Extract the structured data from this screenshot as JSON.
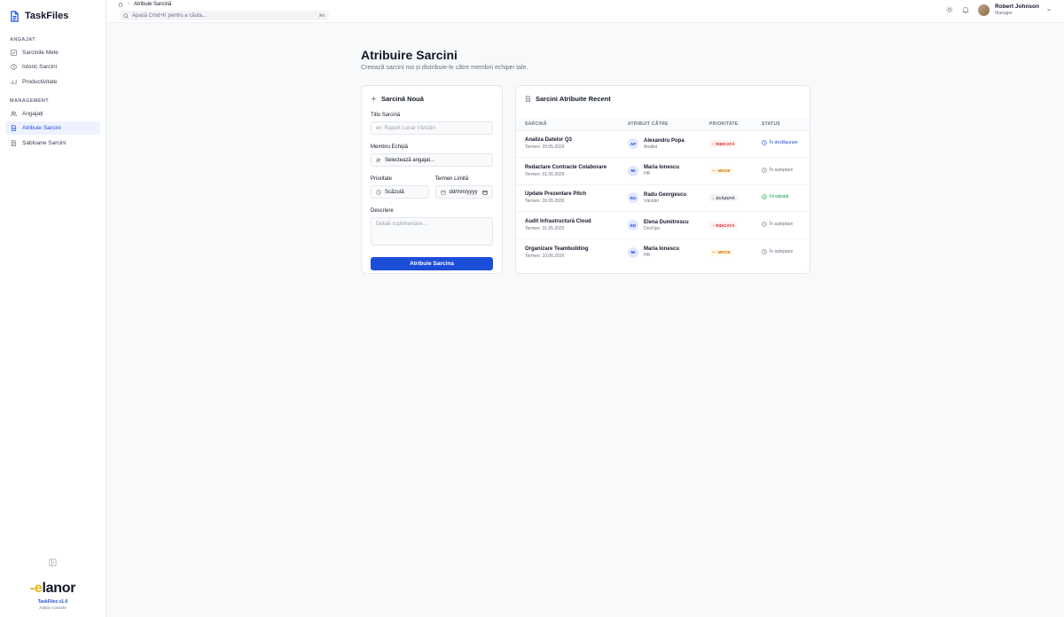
{
  "brand": {
    "name": "TaskFiles"
  },
  "sidebar": {
    "sections": [
      {
        "label": "ANGAJAT",
        "items": [
          {
            "label": "Sarcinile Mele",
            "icon": "checklist-icon"
          },
          {
            "label": "Istoric Sarcini",
            "icon": "history-icon"
          },
          {
            "label": "Productivitate",
            "icon": "chart-icon"
          }
        ]
      },
      {
        "label": "MANAGEMENT",
        "items": [
          {
            "label": "Angajați",
            "icon": "users-icon"
          },
          {
            "label": "Atribuie Sarcini",
            "icon": "document-icon"
          },
          {
            "label": "Șabloane Sarcini",
            "icon": "template-icon"
          }
        ]
      }
    ],
    "footer": {
      "logo": "elanor",
      "version": "TaskFiles v1.0",
      "subtitle": "Admin Console"
    }
  },
  "topbar": {
    "breadcrumb": "Atribuie Sarcină",
    "search_placeholder": "Apasă Cmd+K pentru a căuta...",
    "search_kbd": "⌘K",
    "user": {
      "name": "Robert Johnson",
      "role": "Manager"
    }
  },
  "page": {
    "title": "Atribuire Sarcini",
    "subtitle": "Creează sarcini noi și distribuie-le către membrii echipei tale."
  },
  "form": {
    "title": "Sarcină Nouă",
    "task_title_label": "Titlu Sarcină",
    "task_title_placeholder": "ex: Raport Lunar Vânzări",
    "member_label": "Membru Echipă",
    "member_value": "Selectează angajat...",
    "priority_label": "Prioritate",
    "priority_value": "Scăzută",
    "deadline_label": "Termen Limită",
    "deadline_placeholder": "dd/mm/yyyy",
    "description_label": "Descriere",
    "description_placeholder": "Detalii suplimentare...",
    "submit_label": "Atribuie Sarcina"
  },
  "recent": {
    "title": "Sarcini Atribuite Recent",
    "columns": [
      "SARCINĂ",
      "ATRIBUIT CĂTRE",
      "PRIORITATE",
      "STATUS"
    ],
    "rows": [
      {
        "task": "Analiza Datelor Q3",
        "due": "Termen: 29.05.2026",
        "initials": "AP",
        "assignee": "Alexandru Popa",
        "role": "Analist",
        "priority": "RIDICATĂ",
        "priority_level": "high",
        "status": "În desfășurare",
        "status_kind": "prog"
      },
      {
        "task": "Redactare Contracte Colaborare",
        "due": "Termen: 01.06.2026",
        "initials": "MI",
        "assignee": "Maria Ionescu",
        "role": "HR",
        "priority": "MEDIE",
        "priority_level": "med",
        "status": "În așteptare",
        "status_kind": "wait"
      },
      {
        "task": "Update Prezentare Pitch",
        "due": "Termen: 26.05.2026",
        "initials": "RG",
        "assignee": "Radu Georgescu",
        "role": "Vânzări",
        "priority": "SCĂZUTĂ",
        "priority_level": "low",
        "status": "Finalizată",
        "status_kind": "done"
      },
      {
        "task": "Audit Infrastructură Cloud",
        "due": "Termen: 31.05.2026",
        "initials": "ED",
        "assignee": "Elena Dumitrescu",
        "role": "DevOps",
        "priority": "RIDICATĂ",
        "priority_level": "high",
        "status": "În așteptare",
        "status_kind": "wait"
      },
      {
        "task": "Organizare Teambuilding",
        "due": "Termen: 10.06.2026",
        "initials": "MI",
        "assignee": "Maria Ionescu",
        "role": "HR",
        "priority": "MEDIE",
        "priority_level": "med",
        "status": "În așteptare",
        "status_kind": "wait"
      }
    ]
  }
}
